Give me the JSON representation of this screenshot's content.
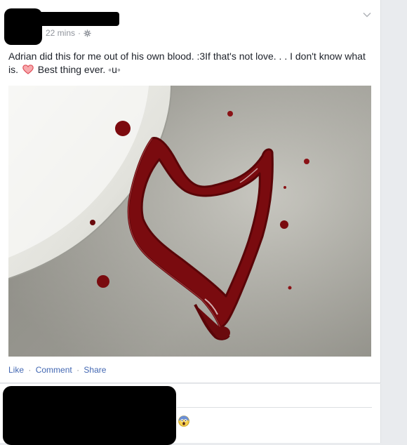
{
  "post": {
    "timestamp": "22 mins",
    "dot": "·",
    "privacy_icon": "gear-icon",
    "text_part1": "Adrian did this for me out of his own blood. :3If that's not love. . . I don't know what is.",
    "text_part2": "Best thing ever. ◦u◦",
    "emoji": "heart-emoji",
    "image_alt": "photo of blood shaped into a heart on a floor next to a toilet",
    "actions": {
      "like": "Like",
      "comment": "Comment",
      "share": "Share",
      "separator": "·"
    }
  },
  "comment": {
    "emoji": "face-screaming-emoji"
  },
  "colors": {
    "link": "#4267b2",
    "meta": "#90949c",
    "text": "#1d2129",
    "background": "#e9ebee"
  }
}
